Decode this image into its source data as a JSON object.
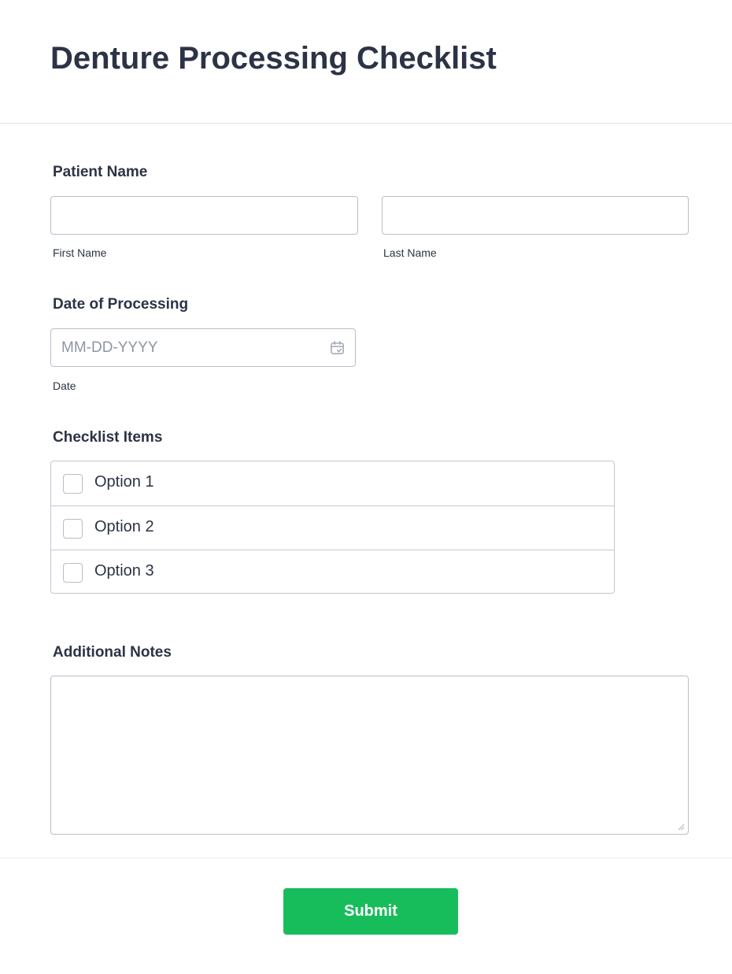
{
  "form": {
    "title": "Denture Processing Checklist"
  },
  "patient_name": {
    "label": "Patient Name",
    "first_name": {
      "value": "",
      "sublabel": "First Name"
    },
    "last_name": {
      "value": "",
      "sublabel": "Last Name"
    }
  },
  "date_of_processing": {
    "label": "Date of Processing",
    "value": "",
    "placeholder": "MM-DD-YYYY",
    "sublabel": "Date",
    "icon": "calendar-icon"
  },
  "checklist": {
    "label": "Checklist Items",
    "options": [
      {
        "label": "Option 1",
        "checked": false
      },
      {
        "label": "Option 2",
        "checked": false
      },
      {
        "label": "Option 3",
        "checked": false
      }
    ]
  },
  "additional_notes": {
    "label": "Additional Notes",
    "value": ""
  },
  "submit": {
    "label": "Submit"
  },
  "colors": {
    "text": "#2c3345",
    "border": "#b8bdc9",
    "submit_background": "#18bd5b",
    "placeholder": "#8f96a3"
  }
}
